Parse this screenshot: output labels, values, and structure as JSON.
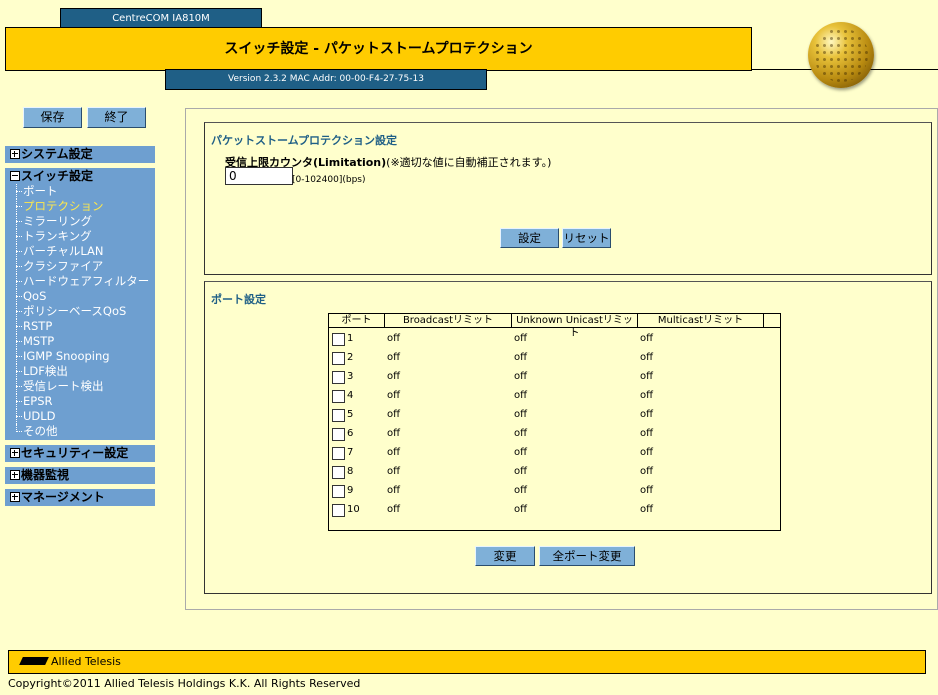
{
  "header": {
    "model": "CentreCOM IA810M",
    "title": "スイッチ設定 - パケットストームプロテクション",
    "version": "Version 2.3.2 MAC Addr: 00-00-F4-27-75-13"
  },
  "nav": {
    "save_label": "保存",
    "exit_label": "終了",
    "sections": {
      "system": "システム設定",
      "switch": "スイッチ設定",
      "security": "セキュリティー設定",
      "monitor": "機器監視",
      "management": "マネージメント"
    },
    "switch_items": [
      "ポート",
      "プロテクション",
      "ミラーリング",
      "トランキング",
      "バーチャルLAN",
      "クラシファイア",
      "ハードウェアフィルター",
      "QoS",
      "ポリシーベースQoS",
      "RSTP",
      "MSTP",
      "IGMP Snooping",
      "LDF検出",
      "受信レート検出",
      "EPSR",
      "UDLD",
      "その他"
    ],
    "active_item": "プロテクション"
  },
  "storm": {
    "title": "パケットストームプロテクション設定",
    "limit_label": "受信上限カウンタ(Limitation)",
    "limit_note": "(※適切な値に自動補正されます。)",
    "limit_value": "0",
    "limit_range": "[0-102400](bps)",
    "set_label": "設定",
    "reset_label": "リセット"
  },
  "ports": {
    "title": "ポート設定",
    "columns": [
      "ポート",
      "Broadcastリミット",
      "Unknown Unicastリミット",
      "Multicastリミット"
    ],
    "rows": [
      {
        "port": "1",
        "broadcast": "off",
        "unicast": "off",
        "multicast": "off"
      },
      {
        "port": "2",
        "broadcast": "off",
        "unicast": "off",
        "multicast": "off"
      },
      {
        "port": "3",
        "broadcast": "off",
        "unicast": "off",
        "multicast": "off"
      },
      {
        "port": "4",
        "broadcast": "off",
        "unicast": "off",
        "multicast": "off"
      },
      {
        "port": "5",
        "broadcast": "off",
        "unicast": "off",
        "multicast": "off"
      },
      {
        "port": "6",
        "broadcast": "off",
        "unicast": "off",
        "multicast": "off"
      },
      {
        "port": "7",
        "broadcast": "off",
        "unicast": "off",
        "multicast": "off"
      },
      {
        "port": "8",
        "broadcast": "off",
        "unicast": "off",
        "multicast": "off"
      },
      {
        "port": "9",
        "broadcast": "off",
        "unicast": "off",
        "multicast": "off"
      },
      {
        "port": "10",
        "broadcast": "off",
        "unicast": "off",
        "multicast": "off"
      }
    ],
    "change_label": "変更",
    "change_all_label": "全ポート変更"
  },
  "footer": {
    "logo": "Allied Telesis",
    "copyright": "Copyright©2011 Allied Telesis Holdings K.K. All Rights Reserved"
  },
  "colors": {
    "background": "#ffffcc",
    "title_bar": "#ffcc00",
    "dark_blue": "#1f5f86",
    "nav_blue": "#6e9fd0",
    "button_blue": "#7fb0d8",
    "active_item": "#ffe84a"
  }
}
